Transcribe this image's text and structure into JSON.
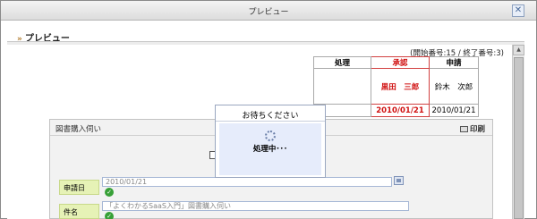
{
  "window": {
    "title": "プレビュー",
    "close_symbol": "✕"
  },
  "page": {
    "heading": "プレビュー",
    "heading_chevron": "»"
  },
  "range_label": "(開始番号:15 / 終了番号:3)",
  "approval_table": {
    "headers": [
      "処理",
      "承認",
      "申請"
    ],
    "names": [
      "",
      "黒田　三郎",
      "鈴木　次郎"
    ],
    "dates": [
      "",
      "2010/01/21",
      "2010/01/21"
    ],
    "approved_color": "#d01010"
  },
  "form": {
    "title": "図書購入伺い",
    "print_label": "印刷",
    "fields": [
      {
        "label": "申請日",
        "value": "2010/01/21"
      },
      {
        "label": "件名",
        "value": "「よくわかるSaaS入門」図書購入伺い"
      }
    ]
  },
  "modal": {
    "title": "お待ちください",
    "message": "処理中･･･"
  },
  "icons": [
    "close-icon",
    "chevron-icon",
    "print-icon",
    "calendar-icon",
    "check-icon",
    "spinner-icon",
    "scroll-up-icon"
  ]
}
